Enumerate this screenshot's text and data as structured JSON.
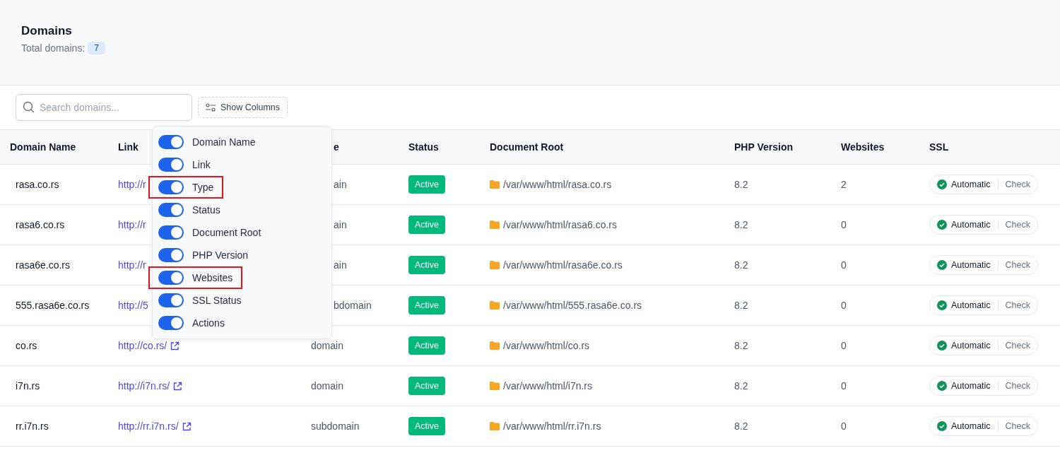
{
  "header": {
    "title": "Domains",
    "total_label": "Total domains:",
    "total_count": "7"
  },
  "toolbar": {
    "search": {
      "placeholder": "Search domains..."
    },
    "columns_button": "Show Columns"
  },
  "table": {
    "columns": [
      {
        "label": "Domain Name"
      },
      {
        "label": "Link"
      },
      {
        "label": "e"
      },
      {
        "label": "Status"
      },
      {
        "label": "Document Root"
      },
      {
        "label": "PHP Version"
      },
      {
        "label": "Websites"
      },
      {
        "label": "SSL"
      }
    ],
    "rows": [
      {
        "domain": "rasa.co.rs",
        "link": "http://r",
        "type": "ain",
        "status": "Active",
        "root": "/var/www/html/rasa.co.rs",
        "php": "8.2",
        "websites": "2",
        "ssl": "Automatic",
        "action": "Check"
      },
      {
        "domain": "rasa6.co.rs",
        "link": "http://r",
        "type": "ain",
        "status": "Active",
        "root": "/var/www/html/rasa6.co.rs",
        "php": "8.2",
        "websites": "0",
        "ssl": "Automatic",
        "action": "Check"
      },
      {
        "domain": "rasa6e.co.rs",
        "link": "http://r",
        "type": "ain",
        "status": "Active",
        "root": "/var/www/html/rasa6e.co.rs",
        "php": "8.2",
        "websites": "0",
        "ssl": "Automatic",
        "action": "Check"
      },
      {
        "domain": "555.rasa6e.co.rs",
        "link": "http://5",
        "type": "bdomain",
        "status": "Active",
        "root": "/var/www/html/555.rasa6e.co.rs",
        "php": "8.2",
        "websites": "0",
        "ssl": "Automatic",
        "action": "Check"
      },
      {
        "domain": "co.rs",
        "link": "http://co.rs/",
        "type": "domain",
        "status": "Active",
        "root": "/var/www/html/co.rs",
        "php": "8.2",
        "websites": "0",
        "ssl": "Automatic",
        "action": "Check"
      },
      {
        "domain": "i7n.rs",
        "link": "http://i7n.rs/",
        "type": "domain",
        "status": "Active",
        "root": "/var/www/html/i7n.rs",
        "php": "8.2",
        "websites": "0",
        "ssl": "Automatic",
        "action": "Check"
      },
      {
        "domain": "rr.i7n.rs",
        "link": "http://rr.i7n.rs/",
        "type": "subdomain",
        "status": "Active",
        "root": "/var/www/html/rr.i7n.rs",
        "php": "8.2",
        "websites": "0",
        "ssl": "Automatic",
        "action": "Check"
      }
    ]
  },
  "columns_menu": {
    "items": [
      {
        "label": "Domain Name",
        "on": true,
        "highlighted": false
      },
      {
        "label": "Link",
        "on": true,
        "highlighted": false
      },
      {
        "label": "Type",
        "on": true,
        "highlighted": true
      },
      {
        "label": "Status",
        "on": true,
        "highlighted": false
      },
      {
        "label": "Document Root",
        "on": true,
        "highlighted": false
      },
      {
        "label": "PHP Version",
        "on": true,
        "highlighted": false
      },
      {
        "label": "Websites",
        "on": true,
        "highlighted": true
      },
      {
        "label": "SSL Status",
        "on": true,
        "highlighted": false
      },
      {
        "label": "Actions",
        "on": true,
        "highlighted": false
      }
    ]
  }
}
